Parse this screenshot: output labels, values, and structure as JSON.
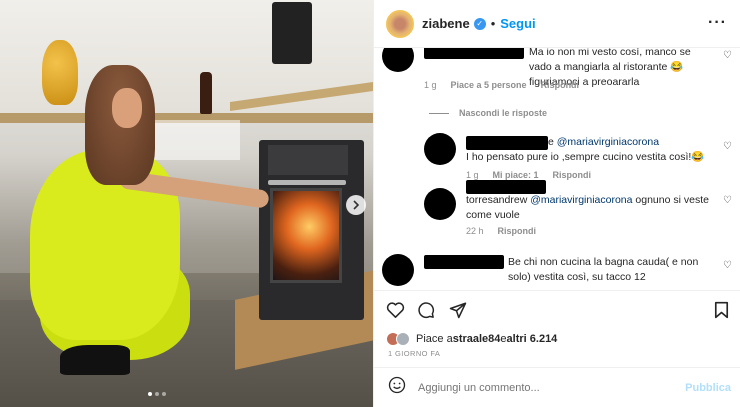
{
  "post": {
    "username": "ziabene",
    "follow_label": "Segui",
    "separator": "•"
  },
  "comments": [
    {
      "text": "Ma io non mi vesto così, manco se vado a mangiarla al ristorante 😂 figuriamoci a preoararla",
      "time": "1 g",
      "likes": "Piace a 5 persone",
      "reply": "Rispondi"
    }
  ],
  "hide_replies_label": "Nascondi le risposte",
  "replies": [
    {
      "prefix": "e",
      "mention": "@mariavirginiacorona",
      "text": " I ho pensato pure io ,sempre cucino vestita così!😂",
      "time": "1 g",
      "likes": "Mi piace: 1",
      "reply": "Rispondi"
    },
    {
      "handle": "torresandrew",
      "mention": "@mariavirginiacorona",
      "text": " ognuno si veste come vuole",
      "time": "22 h",
      "reply": "Rispondi"
    }
  ],
  "comment3": {
    "text": "Be chi non cucina la bagna cauda( e non solo) vestita così, su tacco 12"
  },
  "liked_by": {
    "prefix": "Piace a ",
    "user": "straale84",
    "middle": " e ",
    "others": "altri 6.214"
  },
  "date": "1 GIORNO FA",
  "add_comment": {
    "placeholder": "Aggiungi un commento...",
    "publish": "Pubblica"
  },
  "icons": [
    "verified-icon",
    "more-icon",
    "heart-icon",
    "comment-icon",
    "share-icon",
    "bookmark-icon",
    "emoji-icon",
    "next-arrow-icon"
  ],
  "colors": {
    "accent": "#0095f6",
    "dress": "#d9ea1d"
  }
}
